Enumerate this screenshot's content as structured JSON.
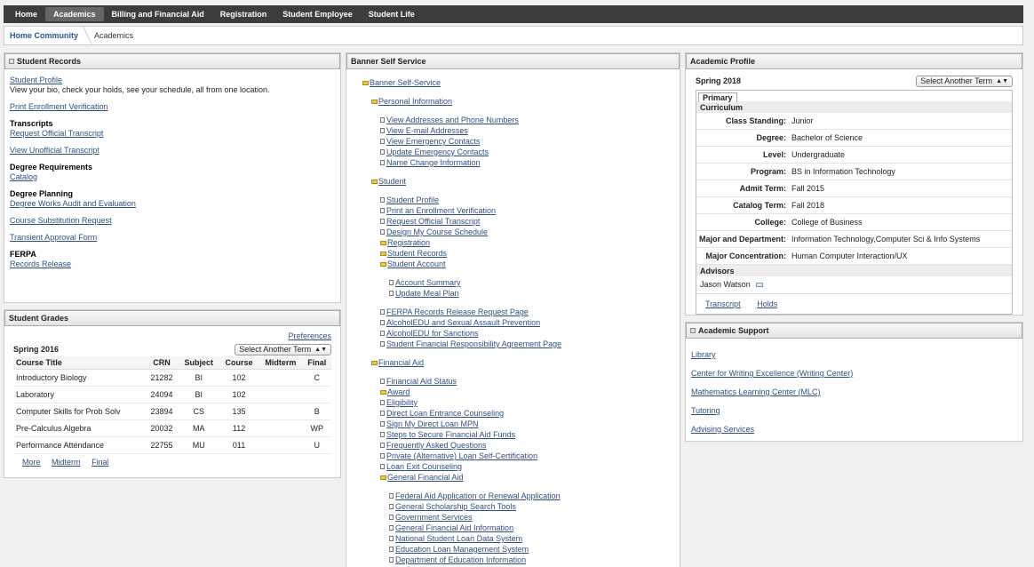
{
  "nav": {
    "tabs": [
      "Home",
      "Academics",
      "Billing and Financial Aid",
      "Registration",
      "Student Employee",
      "Student Life"
    ]
  },
  "breadcrumb": {
    "home": "Home Community",
    "current": "Academics"
  },
  "records": {
    "title": "Student Records",
    "profile_link": "Student Profile",
    "profile_desc": "View your bio, check your holds, see your schedule, all from one location.",
    "print_link": "Print Enrollment Verification",
    "transcripts_heading": "Transcripts",
    "request_transcript": "Request Official Transcript",
    "view_unofficial": "View Unofficial Transcript",
    "degree_req_heading": "Degree Requirements",
    "catalog": "Catalog",
    "degree_planning_heading": "Degree Planning",
    "degree_works": "Degree Works Audit and Evaluation",
    "course_sub": "Course Substitution Request",
    "transient": "Transient Approval Form",
    "ferpa_heading": "FERPA",
    "records_release": "Records Release"
  },
  "grades": {
    "title": "Student Grades",
    "preferences": "Preferences",
    "term": "Spring 2016",
    "select_term": "Select Another Term",
    "columns": [
      "Course Title",
      "CRN",
      "Subject",
      "Course",
      "Midterm",
      "Final"
    ],
    "rows": [
      [
        "Introductory Biology",
        "21282",
        "BI",
        "102",
        "",
        "C"
      ],
      [
        "Laboratory",
        "24094",
        "BI",
        "102",
        "",
        ""
      ],
      [
        "Computer Skills for Prob Solv",
        "23894",
        "CS",
        "135",
        "",
        "B"
      ],
      [
        "Pre-Calculus Algebra",
        "20032",
        "MA",
        "112",
        "",
        "WP"
      ],
      [
        "Performance Attendance",
        "22755",
        "MU",
        "011",
        "",
        "U"
      ]
    ],
    "footer_links": [
      "More",
      "Midterm",
      "Final"
    ]
  },
  "banner": {
    "title": "Banner Self Service",
    "tree": [
      {
        "lvl": 0,
        "type": "folder",
        "label": "Banner Self-Service"
      },
      {
        "lvl": 1,
        "type": "folder",
        "label": "Personal Information"
      },
      {
        "lvl": 2,
        "type": "page",
        "label": "View Addresses and Phone Numbers"
      },
      {
        "lvl": 2,
        "type": "page",
        "label": "View E-mail Addresses"
      },
      {
        "lvl": 2,
        "type": "page",
        "label": "View Emergency Contacts"
      },
      {
        "lvl": 2,
        "type": "page",
        "label": "Update Emergency Contacts"
      },
      {
        "lvl": 2,
        "type": "page",
        "label": "Name Change Information"
      },
      {
        "lvl": 1,
        "type": "folder",
        "label": "Student"
      },
      {
        "lvl": 2,
        "type": "page",
        "label": "Student Profile"
      },
      {
        "lvl": 2,
        "type": "page",
        "label": "Print an Enrollment Verification"
      },
      {
        "lvl": 2,
        "type": "page",
        "label": "Request Official Transcript"
      },
      {
        "lvl": 2,
        "type": "page",
        "label": "Design My Course Schedule"
      },
      {
        "lvl": 2,
        "type": "folder",
        "label": "Registration"
      },
      {
        "lvl": 2,
        "type": "folder",
        "label": "Student Records"
      },
      {
        "lvl": 2,
        "type": "folder",
        "label": "Student Account"
      },
      {
        "lvl": 3,
        "type": "page",
        "label": "Account Summary"
      },
      {
        "lvl": 3,
        "type": "page",
        "label": "Update Meal Plan"
      },
      {
        "lvl": 2,
        "type": "page",
        "label": "FERPA Records Release Request Page"
      },
      {
        "lvl": 2,
        "type": "page",
        "label": "AlcoholEDU and Sexual Assault Prevention"
      },
      {
        "lvl": 2,
        "type": "page",
        "label": "AlcoholEDU for Sanctions"
      },
      {
        "lvl": 2,
        "type": "page",
        "label": "Student Financial Responsibility Agreement Page"
      },
      {
        "lvl": 1,
        "type": "folder",
        "label": "Financial Aid"
      },
      {
        "lvl": 2,
        "type": "page",
        "label": "Financial Aid Status"
      },
      {
        "lvl": 2,
        "type": "folder",
        "label": "Award"
      },
      {
        "lvl": 2,
        "type": "page",
        "label": "Eligibility"
      },
      {
        "lvl": 2,
        "type": "page",
        "label": "Direct Loan Entrance Counseling"
      },
      {
        "lvl": 2,
        "type": "page",
        "label": "Sign My Direct Loan MPN"
      },
      {
        "lvl": 2,
        "type": "page",
        "label": "Steps to Secure Financial Aid Funds"
      },
      {
        "lvl": 2,
        "type": "page",
        "label": "Frequently Asked Questions"
      },
      {
        "lvl": 2,
        "type": "page",
        "label": "Private (Alternative) Loan Self-Certification"
      },
      {
        "lvl": 2,
        "type": "page",
        "label": "Loan Exit Counseling"
      },
      {
        "lvl": 2,
        "type": "folder",
        "label": "General Financial Aid"
      },
      {
        "lvl": 3,
        "type": "page",
        "label": "Federal Aid Application or Renewal Application"
      },
      {
        "lvl": 3,
        "type": "page",
        "label": "General Scholarship Search Tools"
      },
      {
        "lvl": 3,
        "type": "page",
        "label": "Government Services"
      },
      {
        "lvl": 3,
        "type": "page",
        "label": "General Financial Aid Information"
      },
      {
        "lvl": 3,
        "type": "page",
        "label": "National Student Loan Data System"
      },
      {
        "lvl": 3,
        "type": "page",
        "label": "Education Loan Management System"
      },
      {
        "lvl": 3,
        "type": "page",
        "label": "Department of Education Information"
      }
    ]
  },
  "profile": {
    "title": "Academic Profile",
    "term": "Spring 2018",
    "select_term": "Select Another Term",
    "tab": "Primary",
    "curriculum_label": "Curriculum",
    "fields": [
      [
        "Class Standing:",
        "Junior"
      ],
      [
        "Degree:",
        "Bachelor of Science"
      ],
      [
        "Level:",
        "Undergraduate"
      ],
      [
        "Program:",
        "BS in Information Technology"
      ],
      [
        "Admit Term:",
        "Fall 2015"
      ],
      [
        "Catalog Term:",
        "Fall 2018"
      ],
      [
        "College:",
        "College of Business"
      ],
      [
        "Major and Department:",
        "Information Technology,Computer Sci & Info Systems"
      ],
      [
        "Major Concentration:",
        "Human Computer Interaction/UX"
      ]
    ],
    "advisors_label": "Advisors",
    "advisor": "Jason Watson",
    "links": [
      "Transcript",
      "Holds"
    ]
  },
  "support": {
    "title": "Academic Support",
    "links": [
      "Library",
      "Center for Writing Excellence (Writing Center)",
      "Mathematics Learning Center (MLC)",
      "Tutoring",
      "Advising Services"
    ]
  }
}
